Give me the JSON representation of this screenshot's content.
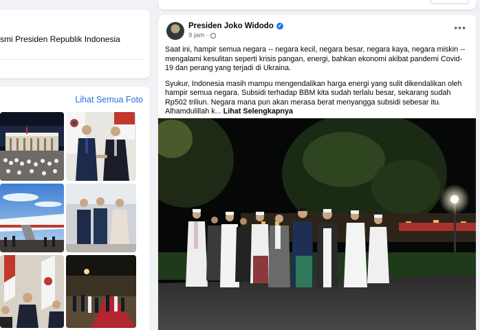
{
  "intro": {
    "text": "smi Presiden Republik Indonesia"
  },
  "photos": {
    "see_all_label": "Lihat Semua Foto"
  },
  "post": {
    "author": "Presiden Joko Widodo",
    "time": "9 jam",
    "paragraphs": [
      "Saat ini, hampir semua negara -- negara kecil, negara besar, negara kaya, negara miskin -- mengalami kesulitan seperti krisis pangan, energi, bahkan ekonomi akibat pandemi Covid-19 dan perang yang terjadi di Ukraina.",
      "Syukur, Indonesia masih mampu mengendalikan harga energi yang sulit dikendalikan oleh hampir semua negara. Subsidi terhadap BBM kita sudah terlalu besar, sekarang sudah Rp502 triliun. Negara mana pun akan merasa berat menyangga subsidi sebesar itu. Alhamdulillah k..."
    ],
    "see_more_label": "Lihat Selengkapnya"
  },
  "colors": {
    "background": "#f0f2f5",
    "card": "#ffffff",
    "link": "#216fdb",
    "verified": "#1877f2",
    "secondary_text": "#65676b"
  },
  "icons": {
    "verified": "verified-badge-icon",
    "privacy": "globe-icon",
    "options": "more-options-icon"
  }
}
